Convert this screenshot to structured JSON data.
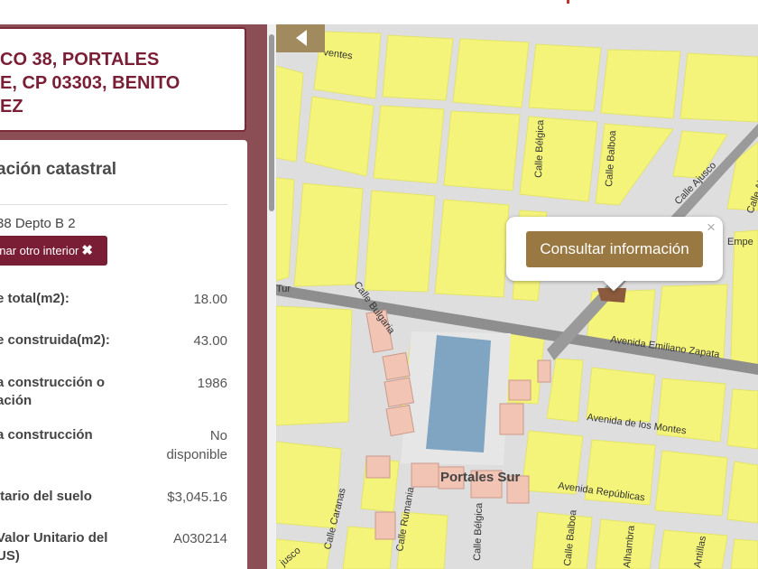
{
  "address": {
    "lines": [
      "CO 38, PORTALES",
      "E, CP 03303, BENITO",
      "EZ"
    ]
  },
  "info": {
    "title": "ación catastral",
    "unit": "38 Depto B 2",
    "select_other_label": "onar otro interior",
    "select_other_icon": "close-x-icon",
    "rows": [
      {
        "label": [
          "e total(m2):"
        ],
        "value": [
          "18.00"
        ]
      },
      {
        "label": [
          "e construida(m2):"
        ],
        "value": [
          "43.00"
        ]
      },
      {
        "label": [
          "a construcción o",
          "ación"
        ],
        "value": [
          "1986"
        ]
      },
      {
        "label": [
          "a construcción"
        ],
        "value": [
          "No",
          "disponible"
        ]
      },
      {
        "label": [
          "itario del suelo"
        ],
        "value": [
          "$3,045.16"
        ]
      },
      {
        "label": [
          " Valor Unitario del",
          "US)"
        ],
        "value": [
          "A030214"
        ]
      }
    ]
  },
  "map": {
    "popup_button": "Consultar información",
    "popup_close": "×",
    "toggle_icon": "collapse-arrow-icon",
    "street_labels": {
      "ventes": "ventes",
      "belgica": "Calle Bélgica",
      "balboa_top": "Calle Balboa",
      "ajusco_top": "Calle Ajusco",
      "ajusco_right": "Calle Ajusco",
      "empe": "Empe",
      "tur": "Tur",
      "bulgaria": "Calle Bulgaria",
      "emiliano": "Avenida Emiliano Zapata",
      "montes": "Avenida de los Montes",
      "republicas": "Avenida Repúblicas",
      "portales": "Portales Sur",
      "caranas": "Calle Caranas",
      "rumania": "Calle Rumania",
      "belgica_bottom": "Calle Bélgica",
      "balboa_bottom": "Calle Balboa",
      "alhambra": "Alhambra",
      "antillas": "Antillas",
      "jusco": "jusco"
    }
  },
  "colors": {
    "accent": "#7a1e36",
    "panel_bg": "#8a4e54",
    "block": "#f5f47a",
    "street": "#dedede",
    "avenue": "#8e8e8e",
    "park": "#7fa5c2",
    "pink_lot": "#f2c4b4",
    "selected_lot": "#8b5a3c",
    "popup_button": "#9a7841"
  }
}
